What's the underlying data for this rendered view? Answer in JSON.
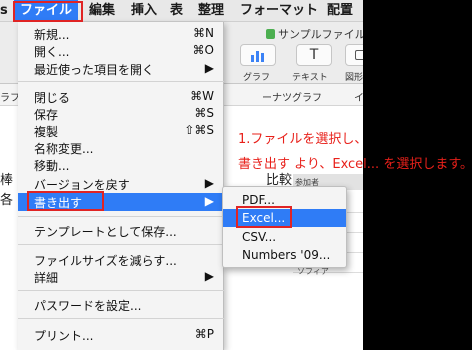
{
  "menubar": {
    "app_fragment": "s",
    "items": [
      "ファイル",
      "編集",
      "挿入",
      "表",
      "整理",
      "フォーマット",
      "配置"
    ]
  },
  "app": {
    "doc_title": "サンプルファイル",
    "toolbar": [
      {
        "icon": "bar-chart-icon",
        "label": "グラフ"
      },
      {
        "icon": "text-icon",
        "glyph": "T",
        "label": "テキスト"
      },
      {
        "icon": "shape-icon",
        "label": "図形"
      }
    ],
    "tabs": {
      "left_fragment": "ラフ",
      "middle": "ーナツグラフ",
      "right_fragment": "イ"
    },
    "canvas": {
      "left_fragment_1": "棒",
      "left_fragment_2": "各",
      "compare_fragment": "比較"
    },
    "table": {
      "header": "参加者",
      "cell": "ソフィア"
    }
  },
  "annotation": {
    "line1": "1.ファイルを選択し、",
    "line2": "書き出す より、Excel... を選択します。"
  },
  "file_menu": {
    "groups": [
      [
        {
          "label": "新規...",
          "shortcut": "⌘N"
        },
        {
          "label": "開く...",
          "shortcut": "⌘O"
        },
        {
          "label": "最近使った項目を開く",
          "shortcut": "▶"
        }
      ],
      [
        {
          "label": "閉じる",
          "shortcut": "⌘W"
        },
        {
          "label": "保存",
          "shortcut": "⌘S"
        },
        {
          "label": "複製",
          "shortcut": "⇧⌘S"
        },
        {
          "label": "名称変更...",
          "shortcut": ""
        },
        {
          "label": "移動...",
          "shortcut": ""
        },
        {
          "label": "バージョンを戻す",
          "shortcut": "▶"
        },
        {
          "label": "書き出す",
          "shortcut": "▶"
        }
      ],
      [
        {
          "label": "テンプレートとして保存...",
          "shortcut": ""
        }
      ],
      [
        {
          "label": "ファイルサイズを減らす...",
          "shortcut": ""
        },
        {
          "label": "詳細",
          "shortcut": "▶"
        }
      ],
      [
        {
          "label": "パスワードを設定...",
          "shortcut": ""
        }
      ],
      [
        {
          "label": "プリント...",
          "shortcut": "⌘P"
        }
      ]
    ]
  },
  "export_submenu": {
    "items": [
      "PDF...",
      "Excel...",
      "CSV...",
      "Numbers '09..."
    ]
  },
  "colors": {
    "highlight": "#2f7cf6",
    "annotation": "#e8201a"
  }
}
